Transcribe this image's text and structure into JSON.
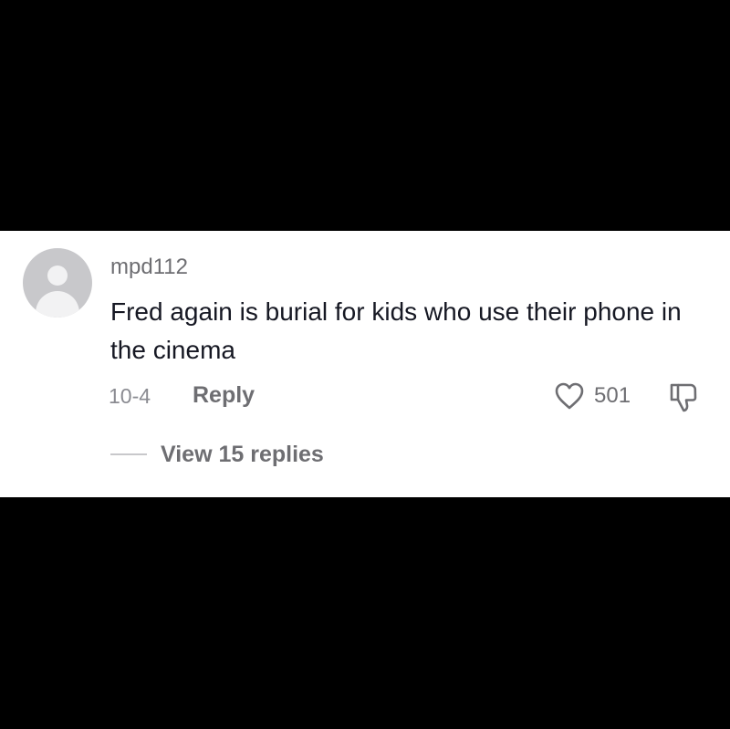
{
  "comment": {
    "username": "mpd112",
    "text": "Fred again is burial for kids who use their phone in the cinema",
    "date": "10-4",
    "reply_label": "Reply",
    "like_count": "501",
    "view_replies_label": "View 15 replies",
    "icons": {
      "avatar": "default-avatar-icon",
      "like": "heart-outline-icon",
      "dislike": "thumbs-down-icon"
    }
  },
  "colors": {
    "background": "#000000",
    "card": "#ffffff",
    "primary_text": "#161823",
    "secondary_text": "#6e6e72",
    "muted_text": "#8a8b91",
    "avatar_gray": "#c8c8cb"
  }
}
